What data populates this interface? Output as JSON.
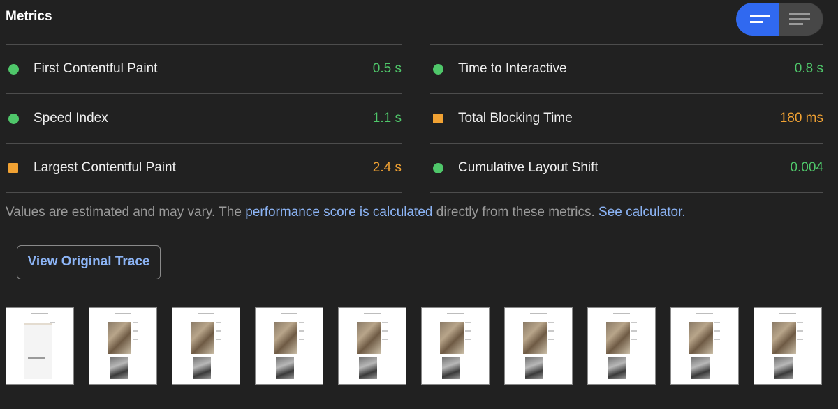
{
  "header": {
    "title": "Metrics",
    "view_toggle": [
      {
        "name": "compact-view",
        "active": true
      },
      {
        "name": "expanded-view",
        "active": false
      }
    ]
  },
  "colors": {
    "pass": "#4fc76a",
    "average": "#f1a233",
    "link": "#8cb4f5",
    "toggle_active": "#3069f0"
  },
  "metrics": {
    "left": [
      {
        "label": "First Contentful Paint",
        "value": "0.5 s",
        "status": "pass"
      },
      {
        "label": "Speed Index",
        "value": "1.1 s",
        "status": "pass"
      },
      {
        "label": "Largest Contentful Paint",
        "value": "2.4 s",
        "status": "average"
      }
    ],
    "right": [
      {
        "label": "Time to Interactive",
        "value": "0.8 s",
        "status": "pass"
      },
      {
        "label": "Total Blocking Time",
        "value": "180 ms",
        "status": "average"
      },
      {
        "label": "Cumulative Layout Shift",
        "value": "0.004",
        "status": "pass"
      }
    ]
  },
  "note": {
    "prefix": "Values are estimated and may vary. The ",
    "link1": "performance score is calculated",
    "middle": " directly from these metrics.",
    "link2": "See calculator."
  },
  "trace_button": "View Original Trace",
  "filmstrip": {
    "frame_count": 10
  }
}
